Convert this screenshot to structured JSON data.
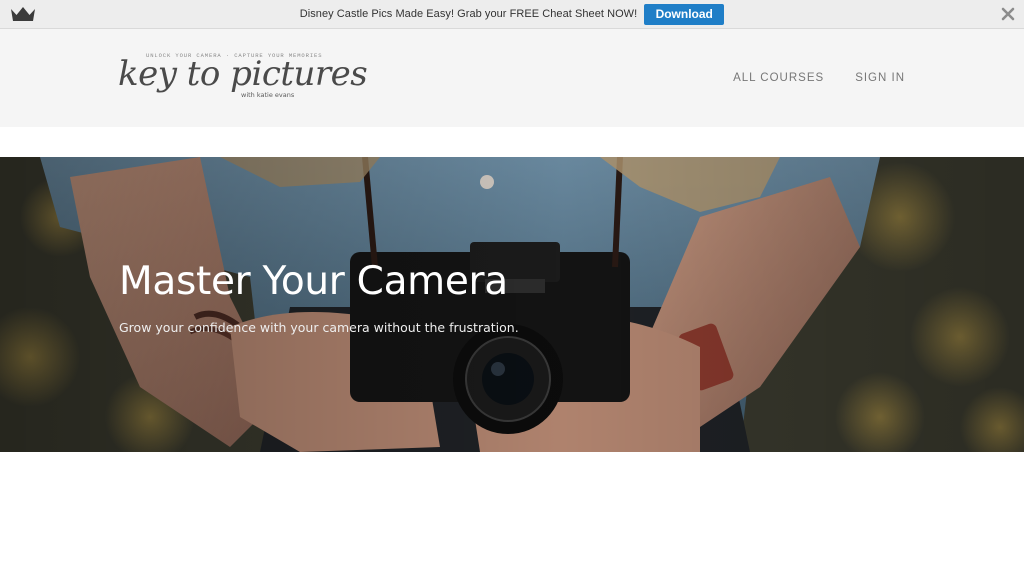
{
  "promo": {
    "text": "Disney Castle Pics Made Easy! Grab your FREE Cheat Sheet NOW!",
    "button_label": "Download",
    "button_color": "#1f7ec7"
  },
  "header": {
    "logo": {
      "tagline": "unlock your camera · capture your memories",
      "name": "key to pictures",
      "byline": "with katie evans"
    },
    "nav": [
      {
        "label": "ALL COURSES"
      },
      {
        "label": "SIGN IN"
      }
    ]
  },
  "hero": {
    "title": "Master Your Camera",
    "subtitle": "Grow your confidence with your camera without the frustration."
  },
  "icons": [
    "crown-icon",
    "close-icon"
  ]
}
